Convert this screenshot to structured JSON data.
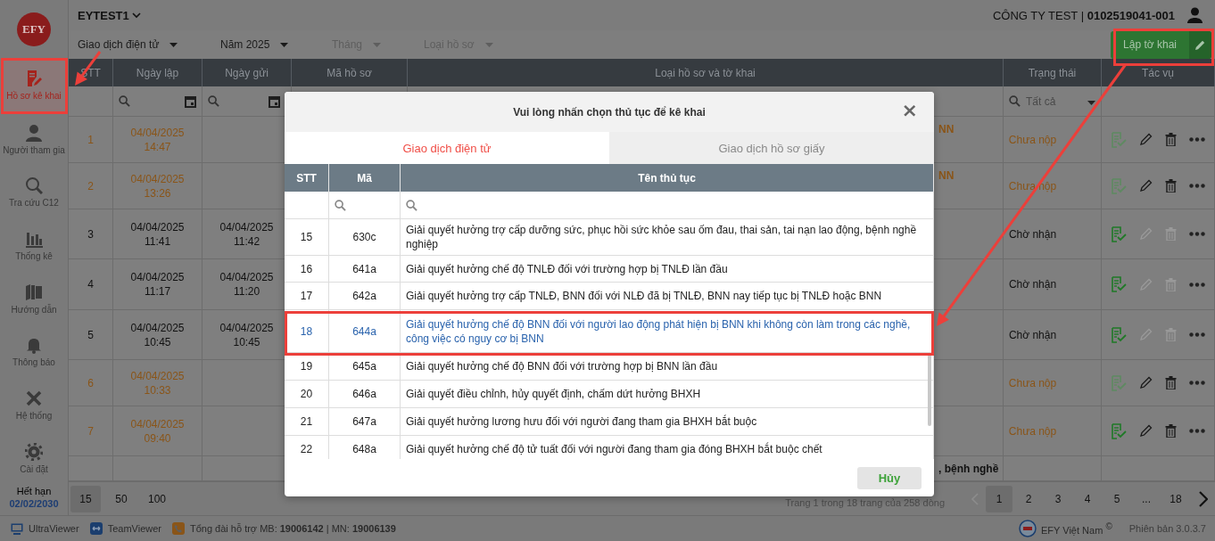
{
  "sidebar": {
    "logo": "EFY",
    "items": [
      {
        "label": "Hồ sơ kê khai",
        "selected": true
      },
      {
        "label": "Người tham gia",
        "selected": false
      },
      {
        "label": "Tra cứu C12",
        "selected": false
      },
      {
        "label": "Thống kê",
        "selected": false
      },
      {
        "label": "Hướng dẫn",
        "selected": false
      },
      {
        "label": "Thông báo",
        "selected": false
      },
      {
        "label": "Hệ thống",
        "selected": false
      },
      {
        "label": "Cài đặt",
        "selected": false
      }
    ],
    "expiry_label": "Hết hạn",
    "expiry_date": "02/02/2030"
  },
  "header": {
    "account": "EYTEST1",
    "company": "CÔNG TY TEST | **0102519041-001**"
  },
  "filters": [
    {
      "label": "Giao dịch điện tử",
      "disabled": false
    },
    {
      "label": "Năm 2025",
      "disabled": false
    },
    {
      "label": "Tháng",
      "disabled": true
    },
    {
      "label": "Loại hồ sơ",
      "disabled": true
    }
  ],
  "create_button": "Lập tờ khai",
  "table": {
    "columns": [
      "STT",
      "Ngày lập",
      "Ngày gửi",
      "Mã hồ sơ",
      "Loại hồ sơ và tờ khai",
      "Trạng thái",
      "Tác vụ"
    ],
    "status_filter": "Tất cả",
    "rows": [
      {
        "stt": "1",
        "created": [
          "04/04/2025",
          "14:47"
        ],
        "type_text": "NN",
        "status": "Chưa nộp",
        "submitted": false,
        "sign_enabled": false
      },
      {
        "stt": "2",
        "created": [
          "04/04/2025",
          "13:26"
        ],
        "type_text": "NN",
        "status": "Chưa nộp",
        "submitted": false,
        "sign_enabled": false
      },
      {
        "stt": "3",
        "created": [
          "04/04/2025",
          "11:41"
        ],
        "sent": [
          "04/04/2025",
          "11:42"
        ],
        "status": "Chờ nhận",
        "submitted": true,
        "sign_enabled": true
      },
      {
        "stt": "4",
        "created": [
          "04/04/2025",
          "11:17"
        ],
        "sent": [
          "04/04/2025",
          "11:20"
        ],
        "status": "Chờ nhận",
        "submitted": true,
        "sign_enabled": true
      },
      {
        "stt": "5",
        "created": [
          "04/04/2025",
          "10:45"
        ],
        "sent": [
          "04/04/2025",
          "10:45"
        ],
        "status": "Chờ nhận",
        "submitted": true,
        "sign_enabled": true
      },
      {
        "stt": "6",
        "created": [
          "04/04/2025",
          "10:33"
        ],
        "status": "Chưa nộp",
        "submitted": false,
        "sign_enabled": false
      },
      {
        "stt": "7",
        "created": [
          "04/04/2025",
          "09:40"
        ],
        "status": "Chưa nộp",
        "submitted": false,
        "sign_enabled": true
      },
      {
        "type_text": ", bệnh nghề"
      }
    ]
  },
  "pager": {
    "sizes": [
      {
        "label": "15",
        "selected": true
      },
      {
        "label": "50",
        "selected": false
      },
      {
        "label": "100",
        "selected": false
      }
    ],
    "summary": "Trang 1 trong 18 trang của 258 dòng",
    "prev": {
      "disabled": true
    },
    "pages": [
      {
        "label": "1",
        "selected": true
      },
      {
        "label": "2",
        "selected": false
      },
      {
        "label": "3",
        "selected": false
      },
      {
        "label": "4",
        "selected": false
      },
      {
        "label": "5",
        "selected": false
      },
      {
        "label": "...",
        "selected": false
      },
      {
        "label": "18",
        "selected": false
      }
    ],
    "next": {
      "disabled": false
    }
  },
  "footer": {
    "tools": [
      "UltraViewer",
      "TeamViewer"
    ],
    "hotline": "Tổng đài hỗ trợ MB: **19006142** | MN: **19006139**",
    "brand": "EFY Việt Nam",
    "brand_mark": "©",
    "version": "Phiên bản 3.0.3.7"
  },
  "modal": {
    "title": "Vui lòng nhấn chọn thủ tục để kê khai",
    "close": "×",
    "tabs": [
      {
        "label": "Giao dịch điện tử",
        "selected": true
      },
      {
        "label": "Giao dịch hồ sơ giấy",
        "selected": false
      }
    ],
    "columns": [
      "STT",
      "Mã",
      "Tên thủ tục"
    ],
    "rows": [
      {
        "stt": "15",
        "code": "630c",
        "name": "Giải quyết hưởng trợ cấp dưỡng sức, phục hồi sức khỏe sau ốm đau, thai sản, tai nạn lao động, bệnh nghề nghiệp",
        "selected": false
      },
      {
        "stt": "16",
        "code": "641a",
        "name": "Giải quyết hưởng chế độ TNLĐ đối với trường hợp bị TNLĐ lần đầu",
        "selected": false
      },
      {
        "stt": "17",
        "code": "642a",
        "name": "Giải quyết hưởng trợ cấp TNLĐ, BNN đối với NLĐ đã bị TNLĐ, BNN nay tiếp tục bị TNLĐ hoặc BNN",
        "selected": false
      },
      {
        "stt": "18",
        "code": "644a",
        "name": "Giải quyết hưởng chế độ BNN đối với người lao động phát hiện bị BNN khi không còn làm trong các nghề, công việc có nguy cơ bị BNN",
        "selected": true
      },
      {
        "stt": "19",
        "code": "645a",
        "name": "Giải quyết hưởng chế độ BNN đối với trường hợp bị BNN lần đầu",
        "selected": false
      },
      {
        "stt": "20",
        "code": "646a",
        "name": "Giải quyết điều chỉnh, hủy quyết định, chấm dứt hưởng BHXH",
        "selected": false
      },
      {
        "stt": "21",
        "code": "647a",
        "name": "Giải quyết hưởng lương hưu đối với người đang tham gia BHXH bắt buộc",
        "selected": false
      },
      {
        "stt": "22",
        "code": "648a",
        "name": "Giải quyết hưởng chế độ tử tuất đối với người đang tham gia đóng BHXH bắt buộc chết",
        "selected": false
      }
    ],
    "cancel": "Hủy"
  }
}
